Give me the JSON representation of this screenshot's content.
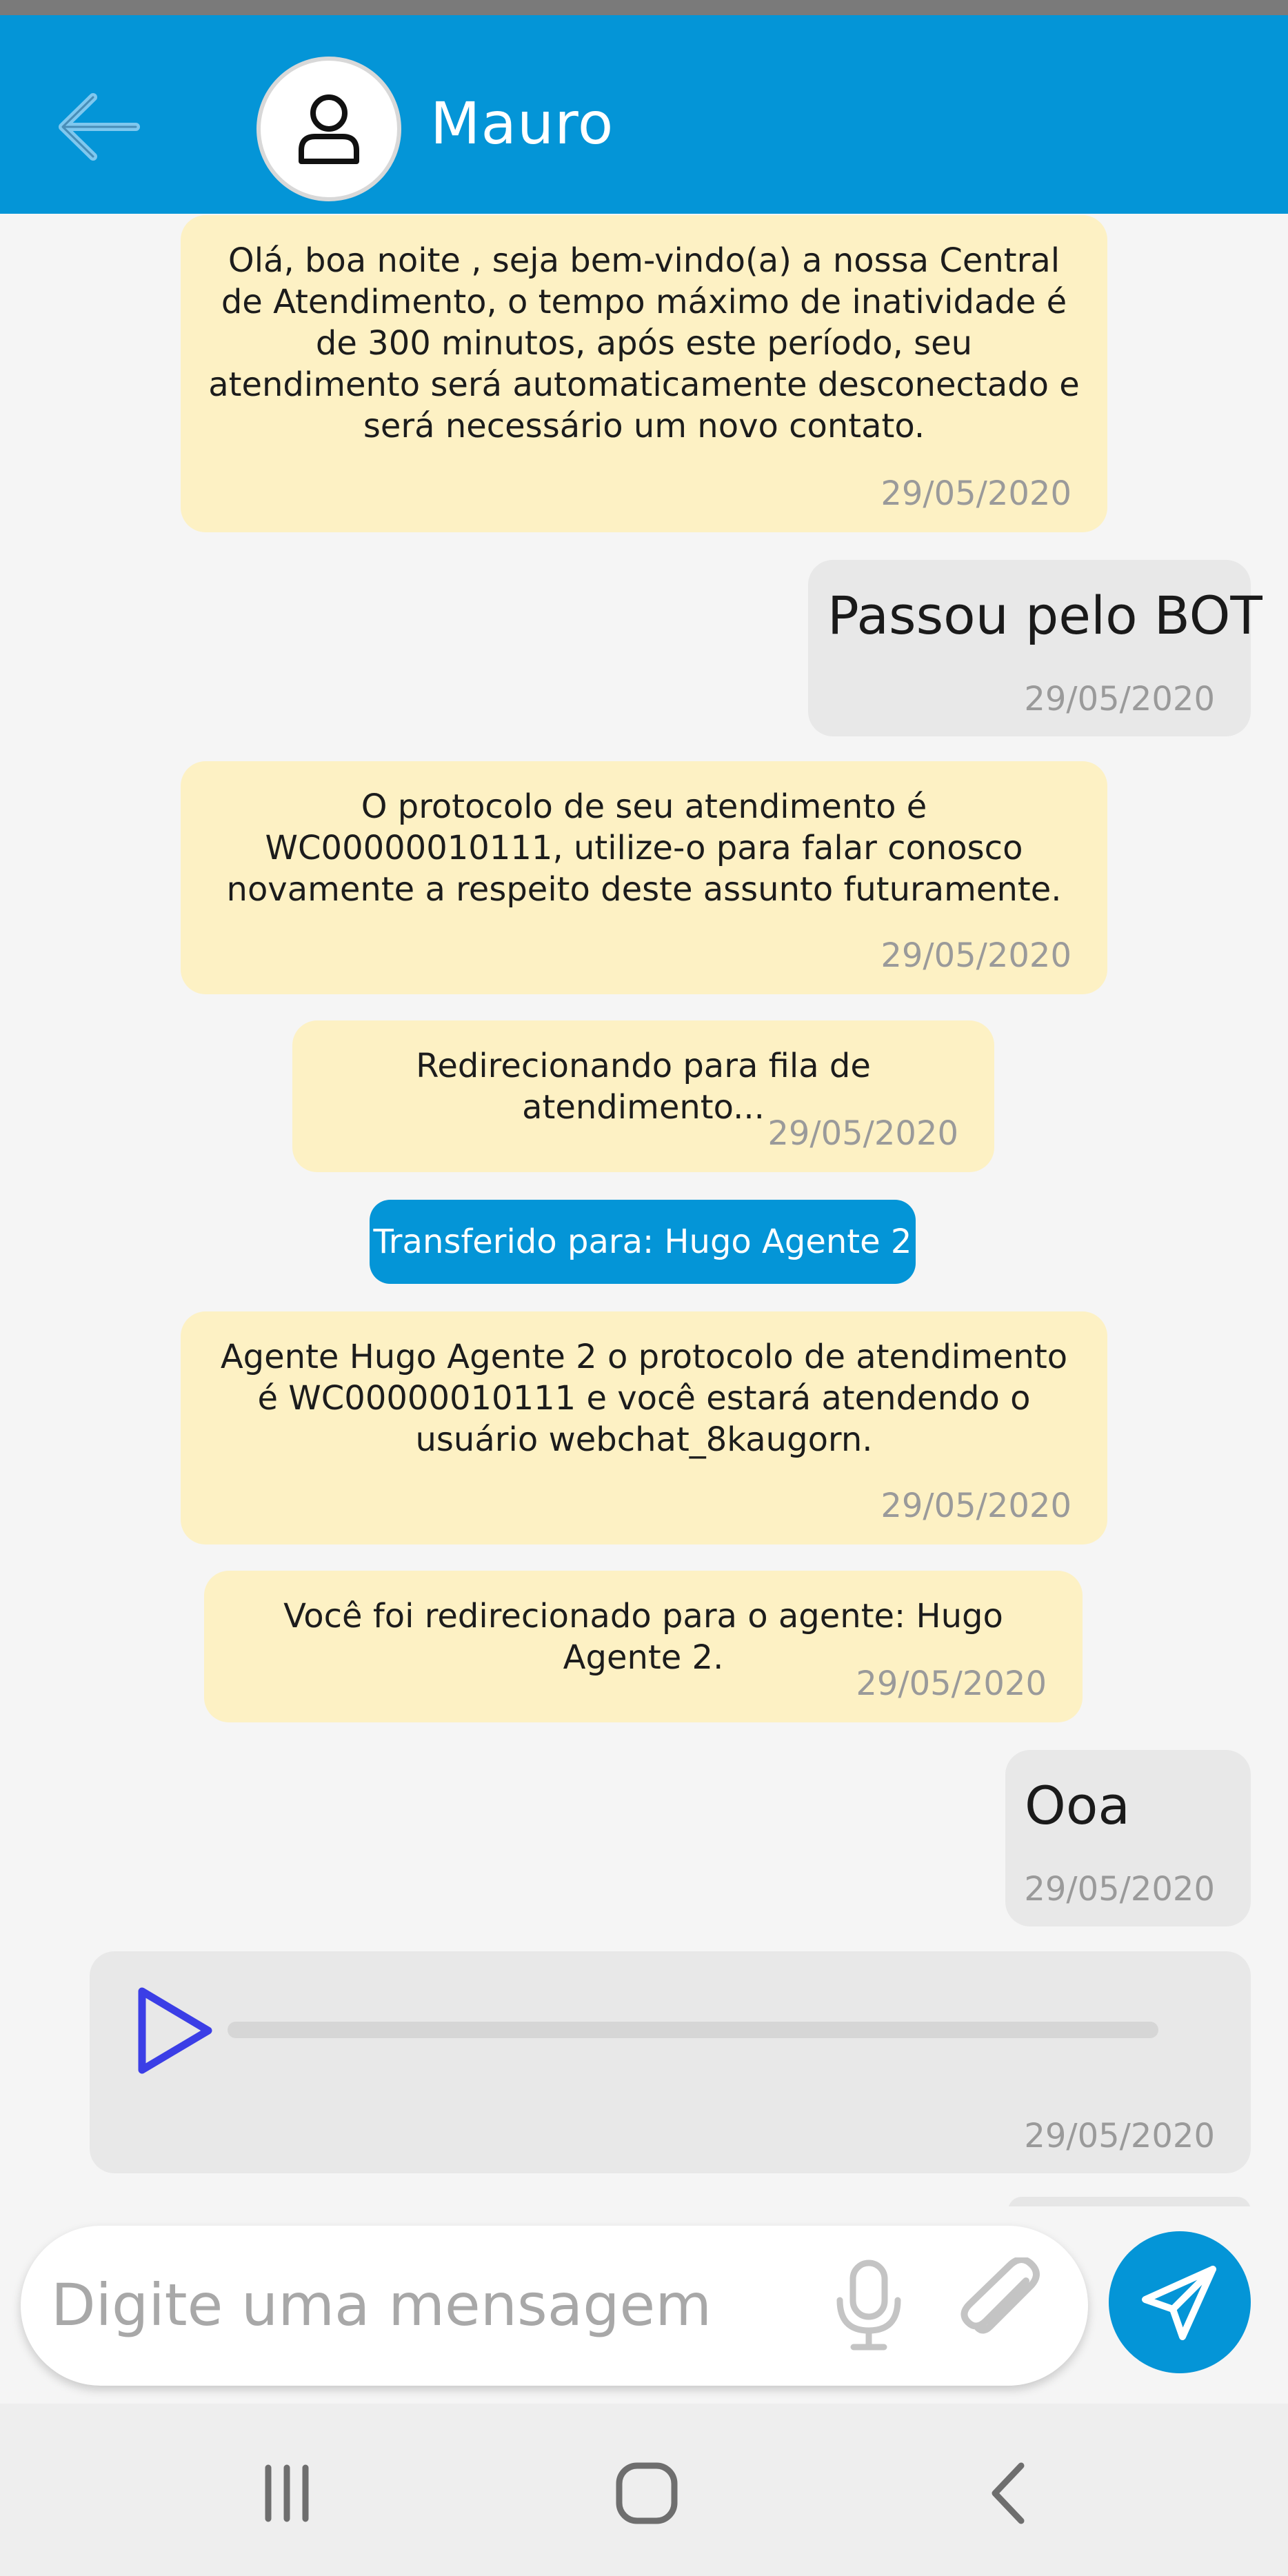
{
  "header": {
    "contact_name": "Mauro",
    "back_icon": "arrow-left-icon",
    "avatar_icon": "user-icon",
    "background_color": "#0495d7"
  },
  "messages": [
    {
      "type": "bot",
      "text": "Olá, boa noite , seja bem-vindo(a) a nossa Central de Atendimento, o tempo máximo de inatividade é de 300 minutos, após este período, seu atendimento será automaticamente desconectado e será necessário um novo contato.",
      "time": "29/05/2020"
    },
    {
      "type": "user",
      "text": "Passou pelo BOT",
      "time": "29/05/2020"
    },
    {
      "type": "bot",
      "text": "O protocolo de seu atendimento é WC00000010111, utilize-o para falar conosco novamente a respeito deste assunto futuramente.",
      "time": "29/05/2020"
    },
    {
      "type": "bot",
      "text": "Redirecionando para fila de atendimento...",
      "time": "29/05/2020"
    },
    {
      "type": "transfer",
      "text": "Transferido para: Hugo Agente 2"
    },
    {
      "type": "bot",
      "text": "Agente Hugo Agente 2 o protocolo de atendimento é WC00000010111 e você estará atendendo o usuário webchat_8kaugorn.",
      "time": "29/05/2020"
    },
    {
      "type": "bot",
      "text": "Você foi redirecionado para o agente: Hugo Agente 2.",
      "time": "29/05/2020"
    },
    {
      "type": "user",
      "text": "Ooa",
      "time": "29/05/2020"
    },
    {
      "type": "audio",
      "progress": 0,
      "time": "29/05/2020",
      "icon": "play-icon"
    }
  ],
  "composer": {
    "placeholder": "Digite uma mensagem",
    "value": "",
    "mic_icon": "microphone-icon",
    "attach_icon": "paperclip-icon",
    "send_icon": "send-icon"
  },
  "nav": {
    "recents_icon": "recent-apps-icon",
    "home_icon": "home-icon",
    "back_icon": "back-chevron-icon"
  },
  "colors": {
    "accent": "#0495d7",
    "bot_bubble": "#fdf1c4",
    "user_bubble": "#e8e8e8",
    "play_icon": "#3b3ee6"
  }
}
